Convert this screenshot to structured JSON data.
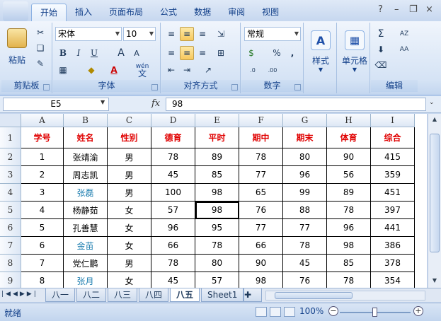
{
  "ribbon_tabs": [
    "开始",
    "插入",
    "页面布局",
    "公式",
    "数据",
    "审阅",
    "视图"
  ],
  "ribbon": {
    "clipboard": {
      "paste_label": "粘贴",
      "group_label": "剪贴板"
    },
    "font": {
      "name": "宋体",
      "size": "10",
      "group_label": "字体",
      "bold": "B",
      "italic": "I",
      "underline": "U",
      "wen": "wén",
      "wen_char": "文"
    },
    "alignment": {
      "group_label": "对齐方式"
    },
    "number": {
      "format": "常规",
      "percent": "%",
      "comma": ",",
      "group_label": "数字"
    },
    "styles": {
      "label": "样式"
    },
    "cells": {
      "label": "单元格"
    },
    "editing": {
      "group_label": "编辑",
      "sum": "Σ",
      "sort": "AZ",
      "find": "AA"
    }
  },
  "formula_bar": {
    "name_box": "E5",
    "fx": "fx",
    "content": "98"
  },
  "columns": [
    "A",
    "B",
    "C",
    "D",
    "E",
    "F",
    "G",
    "H",
    "I"
  ],
  "rows": [
    "1",
    "2",
    "3",
    "4",
    "5",
    "6",
    "7",
    "8",
    "9"
  ],
  "table": {
    "headers": [
      "学号",
      "姓名",
      "性别",
      "德育",
      "平时",
      "期中",
      "期末",
      "体育",
      "综合"
    ],
    "data": [
      [
        "1",
        "张靖渝",
        "男",
        "78",
        "89",
        "78",
        "80",
        "90",
        "415"
      ],
      [
        "2",
        "周志凯",
        "男",
        "45",
        "85",
        "77",
        "96",
        "56",
        "359"
      ],
      [
        "3",
        "张磊",
        "男",
        "100",
        "98",
        "65",
        "99",
        "89",
        "451"
      ],
      [
        "4",
        "杨静茹",
        "女",
        "57",
        "98",
        "76",
        "88",
        "78",
        "397"
      ],
      [
        "5",
        "孔善慧",
        "女",
        "96",
        "95",
        "77",
        "77",
        "96",
        "441"
      ],
      [
        "6",
        "金苗",
        "女",
        "66",
        "78",
        "66",
        "78",
        "98",
        "386"
      ],
      [
        "7",
        "党仁鹏",
        "男",
        "78",
        "80",
        "90",
        "45",
        "85",
        "378"
      ],
      [
        "8",
        "张月",
        "女",
        "45",
        "57",
        "98",
        "76",
        "78",
        "354"
      ]
    ]
  },
  "sheet_tabs": [
    "八一",
    "八二",
    "八三",
    "八四",
    "八五",
    "Sheet1"
  ],
  "status": {
    "text": "就绪",
    "zoom": "100%"
  },
  "colors": {
    "header_red": "#e00000",
    "name_blue": "#1f7fb0",
    "ribbon_text": "#15428b"
  }
}
